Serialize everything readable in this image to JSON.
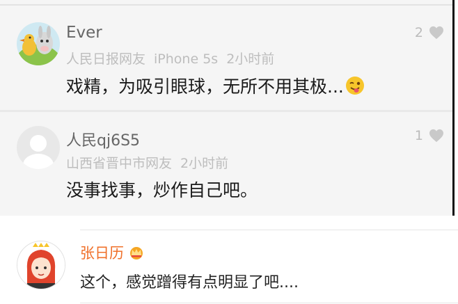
{
  "comments": [
    {
      "username": "Ever",
      "source": "人民日报网友",
      "device": "iPhone 5s",
      "time": "2小时前",
      "text": "戏精，为吸引眼球，无所不用其极...",
      "emoji_icon": "winking-tongue-face-icon",
      "likes": "2"
    },
    {
      "username": "人民qj6S5",
      "source": "山西省晋中市网友",
      "time": "2小时前",
      "text": "没事找事，炒作自己吧。",
      "likes": "1"
    }
  ],
  "weibo_comment": {
    "username": "张日历",
    "badge_icon": "crown-badge-icon",
    "text": "这个，感觉蹭得有点明显了吧...."
  },
  "colors": {
    "panel_bg": "#f5f5f5",
    "username_orange": "#f0702a",
    "meta_gray": "#bdbdbd"
  }
}
